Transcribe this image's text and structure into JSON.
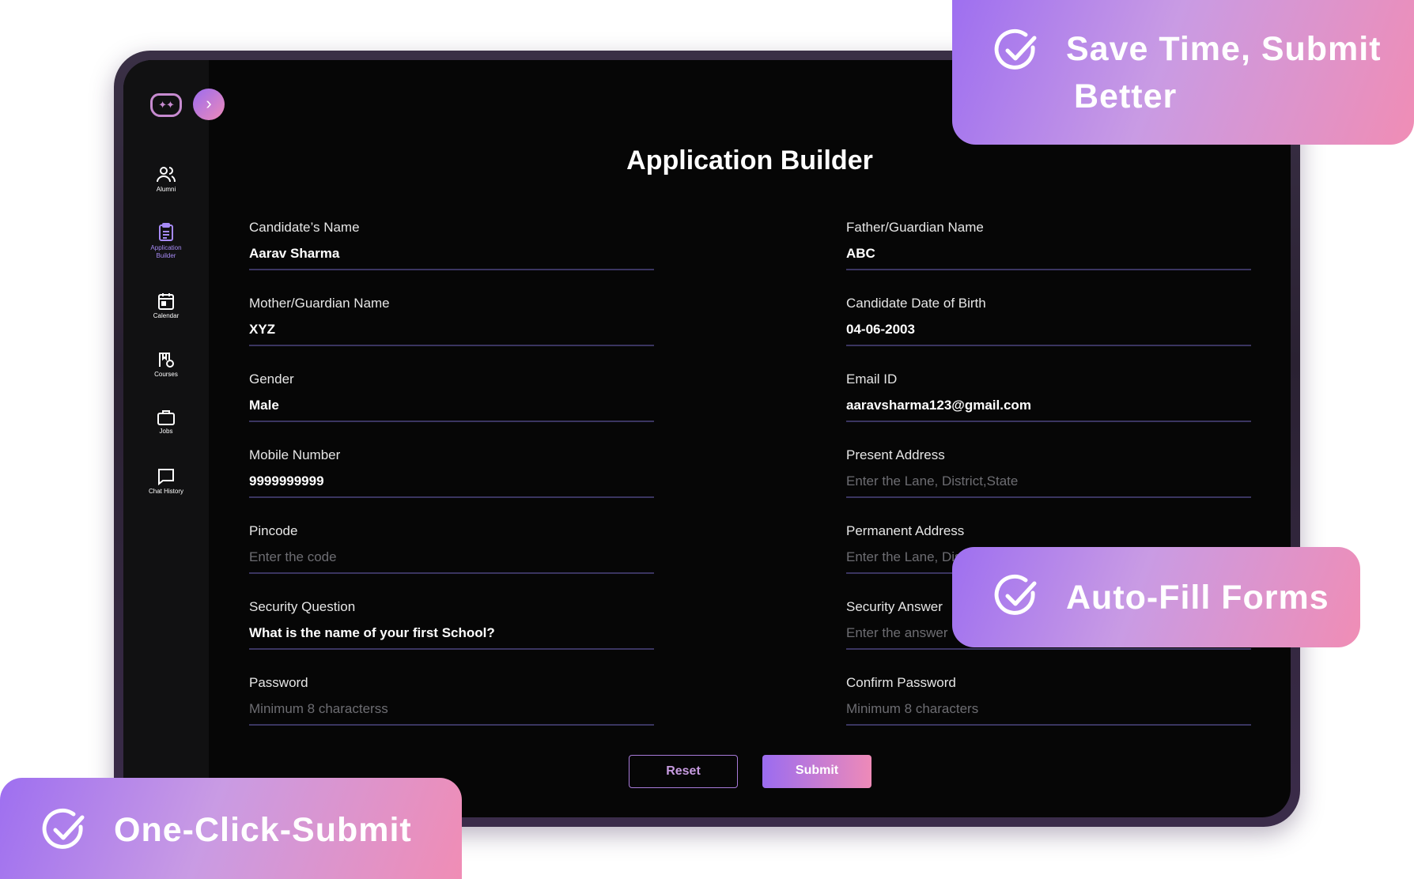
{
  "sidebar": {
    "expand_icon": "chevron-right-icon",
    "items": [
      {
        "label": "Alumni",
        "icon": "users-icon"
      },
      {
        "label": "Application Builder",
        "icon": "clipboard-icon"
      },
      {
        "label": "Calendar",
        "icon": "calendar-icon"
      },
      {
        "label": "Courses",
        "icon": "courses-icon"
      },
      {
        "label": "Jobs",
        "icon": "briefcase-icon"
      },
      {
        "label": "Chat History",
        "icon": "chat-icon"
      }
    ]
  },
  "page": {
    "title": "Application Builder"
  },
  "form": {
    "candidate_name": {
      "label": "Candidate’s Name",
      "value": "Aarav Sharma"
    },
    "father_name": {
      "label": "Father/Guardian Name",
      "value": "ABC"
    },
    "mother_name": {
      "label": "Mother/Guardian Name",
      "value": "XYZ"
    },
    "dob": {
      "label": "Candidate Date of Birth",
      "value": "04-06-2003"
    },
    "gender": {
      "label": "Gender",
      "value": "Male"
    },
    "email": {
      "label": "Email ID",
      "value": "aaravsharma123@gmail.com"
    },
    "mobile": {
      "label": "Mobile Number",
      "value": "9999999999"
    },
    "present_address": {
      "label": "Present Address",
      "placeholder": "Enter the Lane, District,State"
    },
    "pincode": {
      "label": "Pincode",
      "placeholder": "Enter the code"
    },
    "permanent_address": {
      "label": "Permanent Address",
      "placeholder": "Enter the Lane, District,State"
    },
    "security_question": {
      "label": "Security Question",
      "value": "What is the name of your first School?"
    },
    "security_answer": {
      "label": "Security Answer",
      "placeholder": "Enter the answer"
    },
    "password": {
      "label": "Password",
      "placeholder": "Minimum 8 characterss"
    },
    "confirm_password": {
      "label": "Confirm Password",
      "placeholder": "Minimum 8 characters"
    }
  },
  "buttons": {
    "reset": "Reset",
    "submit": "Submit"
  },
  "callouts": {
    "save_time_line1": "Save Time, Submit",
    "save_time_line2": "Better",
    "auto_fill": "Auto-Fill Forms",
    "one_click": "One-Click-Submit"
  },
  "colors": {
    "accent_purple": "#9b6cf0",
    "accent_pink": "#ee8ab8",
    "screen_bg": "#060606"
  }
}
